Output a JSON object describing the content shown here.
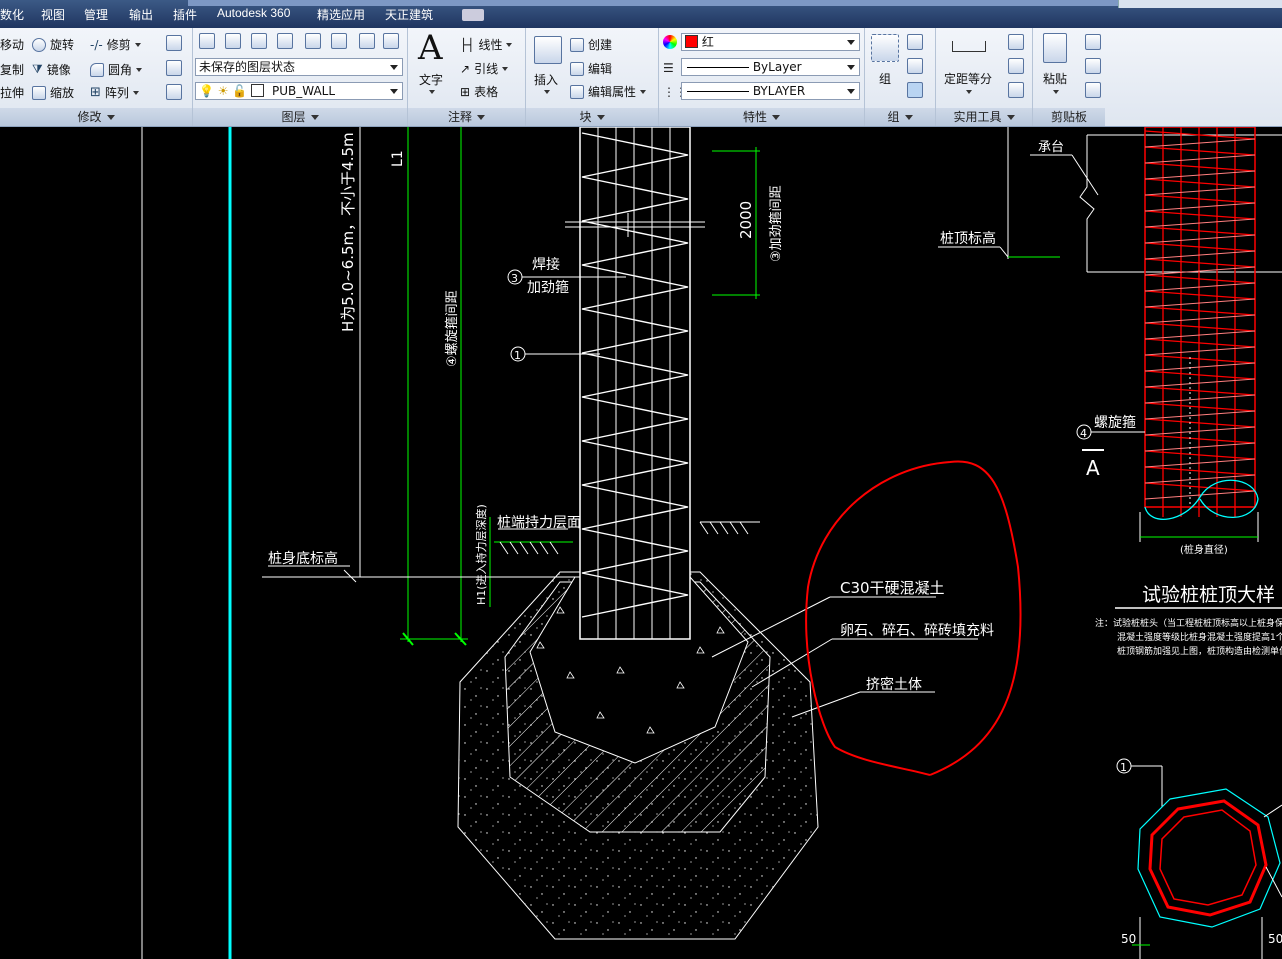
{
  "menu": {
    "items": [
      "数化",
      "视图",
      "管理",
      "输出",
      "插件",
      "Autodesk 360",
      "精选应用",
      "天正建筑"
    ]
  },
  "ribbon": {
    "modify": {
      "title": "修改",
      "buttons": [
        "移动",
        "旋转",
        "修剪",
        "复制",
        "镜像",
        "圆角",
        "拉伸",
        "缩放",
        "阵列"
      ]
    },
    "layers": {
      "title": "图层",
      "layer_state": "未保存的图层状态",
      "current_layer": "PUB_WALL"
    },
    "annotation": {
      "title": "注释",
      "text_label": "文字",
      "items": [
        "线性",
        "引线",
        "表格"
      ]
    },
    "block": {
      "title": "块",
      "insert_label": "插入",
      "items": [
        "创建",
        "编辑",
        "编辑属性"
      ]
    },
    "properties": {
      "title": "特性",
      "color_value": "红",
      "linetype_value": "ByLayer",
      "lineweight_value": "BYLAYER",
      "accent": "#ff0000"
    },
    "group": {
      "title": "组",
      "label": "组"
    },
    "utilities": {
      "title": "实用工具",
      "measure_label": "定距等分"
    },
    "clipboard": {
      "title": "剪贴板",
      "paste_label": "粘贴"
    }
  },
  "drawing": {
    "dims": {
      "h_range": "H为5.0~6.5m，不小于4.5m",
      "l1": "L1",
      "spiral_spacing": "④螺旋箍间距",
      "h1": "H1(进入持力层深度)",
      "d2000": "2000",
      "stiff_spacing": "③加劲箍间距"
    },
    "labels": {
      "weld": "焊接",
      "stiffener": "加劲箍",
      "marker_3": "3",
      "marker_1": "1",
      "bearing_layer": "桩端持力层面",
      "pile_bottom": "桩身底标高",
      "concrete": "C30干硬混凝土",
      "fill": "卵石、碎石、碎砖填充料",
      "soil": "挤密土体"
    },
    "right_detail": {
      "cap": "承台",
      "pile_top": "桩顶标高",
      "spiral": "螺旋箍",
      "marker_4": "4",
      "section": "A",
      "diameter": "(桩身直径)",
      "title": "试验桩桩顶大样",
      "note_line1": "注：试验桩桩头（当工程桩桩顶标高以上桩身保",
      "note_line2": "混凝土强度等级比桩身混凝土强度提高1个",
      "note_line3": "桩顶钢筋加强见上图，桩顶构造由检测单位",
      "marker_1": "1",
      "dim_50_left": "50",
      "dim_50_right": "50"
    },
    "colors": {
      "cyan": "#00ffff",
      "red": "#ff0000",
      "green": "#00ff00",
      "white": "#ffffff",
      "pink": "#ff7f7f"
    }
  }
}
